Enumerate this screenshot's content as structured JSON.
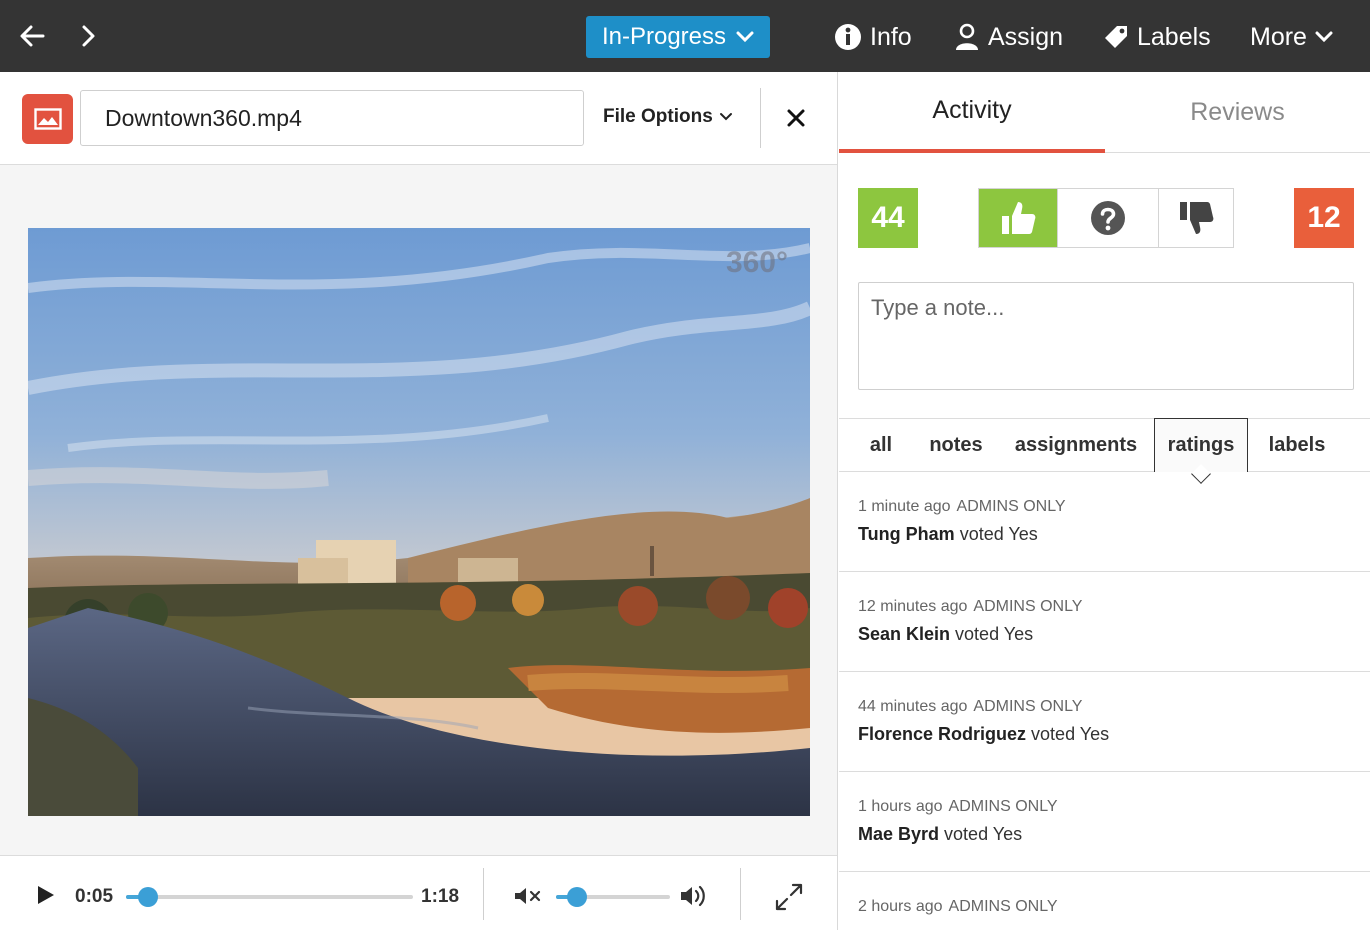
{
  "topbar": {
    "status_label": "In-Progress",
    "info_label": "Info",
    "assign_label": "Assign",
    "labels_label": "Labels",
    "more_label": "More"
  },
  "file": {
    "name": "Downtown360.mp4",
    "options_label": "File Options",
    "badge": "360°"
  },
  "player": {
    "current_time": "0:05",
    "duration": "1:18",
    "progress": 0.077,
    "volume": 0.18
  },
  "panel": {
    "tabs": [
      {
        "label": "Activity",
        "active": true
      },
      {
        "label": "Reviews",
        "active": false
      }
    ],
    "positive_count": "44",
    "negative_count": "12",
    "note_placeholder": "Type a note...",
    "filters": [
      {
        "label": "all"
      },
      {
        "label": "notes"
      },
      {
        "label": "assignments"
      },
      {
        "label": "ratings",
        "active": true
      },
      {
        "label": "labels"
      }
    ],
    "activity": [
      {
        "time": "1 minute ago",
        "scope": "ADMINS ONLY",
        "user": "Tung Pham",
        "action": "voted Yes"
      },
      {
        "time": "12 minutes ago",
        "scope": "ADMINS ONLY",
        "user": "Sean Klein",
        "action": "voted Yes"
      },
      {
        "time": "44 minutes ago",
        "scope": "ADMINS ONLY",
        "user": "Florence Rodriguez",
        "action": "voted Yes"
      },
      {
        "time": "1 hours ago",
        "scope": "ADMINS ONLY",
        "user": "Mae Byrd",
        "action": "voted Yes"
      },
      {
        "time": "2 hours ago",
        "scope": "ADMINS ONLY",
        "user": "",
        "action": ""
      }
    ]
  },
  "colors": {
    "topbar": "#343434",
    "status": "#1e8fc8",
    "positive": "#8dc63f",
    "negative": "#e95f3b",
    "accent": "#e2523f",
    "progress": "#3b9fd6"
  }
}
